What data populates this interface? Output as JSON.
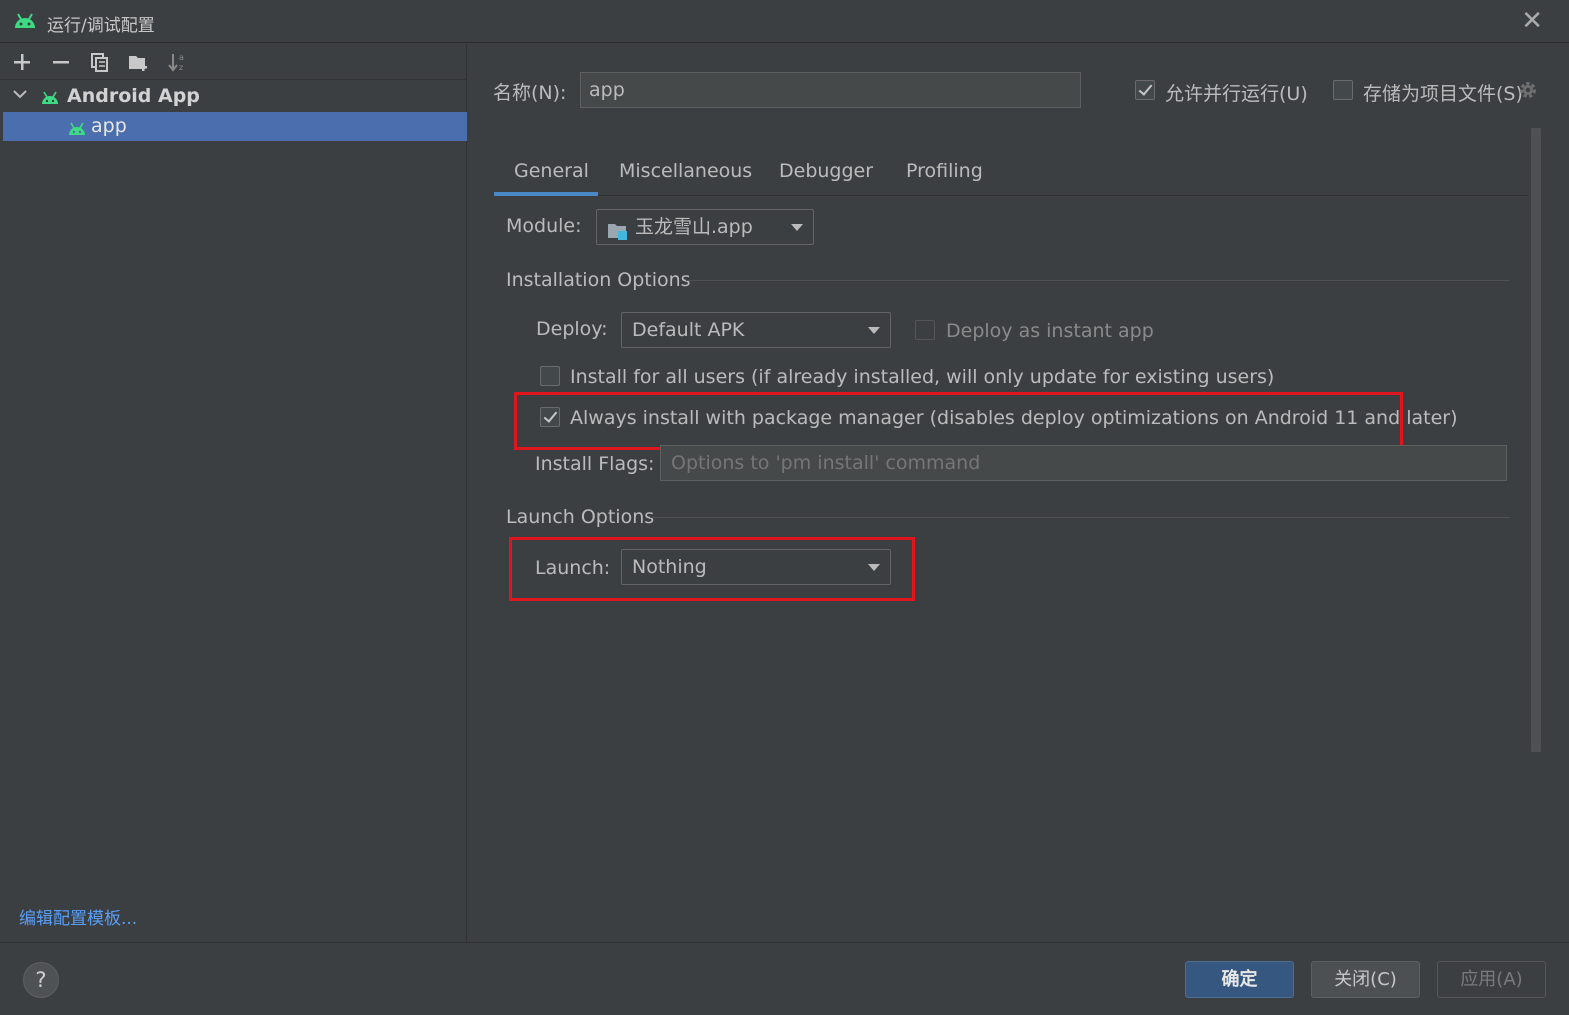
{
  "window": {
    "title": "运行/调试配置",
    "close_symbol": "✕"
  },
  "sidebar": {
    "toolbar_icons": [
      "add-icon",
      "remove-icon",
      "copy-icon",
      "new-folder-icon",
      "sort-icon"
    ],
    "root": {
      "label": "Android App",
      "icon": "android-icon",
      "expanded": true
    },
    "child": {
      "label": "app",
      "icon": "android-icon",
      "selected": true
    },
    "edit_templates_link": "编辑配置模板..."
  },
  "header": {
    "name_label": "名称(N):",
    "name_value": "app",
    "allow_parallel": {
      "label": "允许并行运行(U)",
      "checked": true
    },
    "store_as_file": {
      "label": "存储为项目文件(S)",
      "checked": false
    }
  },
  "tabs": [
    {
      "label": "General",
      "active": true
    },
    {
      "label": "Miscellaneous",
      "active": false
    },
    {
      "label": "Debugger",
      "active": false
    },
    {
      "label": "Profiling",
      "active": false
    }
  ],
  "general": {
    "module_label": "Module:",
    "module_value": "玉龙雪山.app",
    "installation_title": "Installation Options",
    "deploy_label": "Deploy:",
    "deploy_value": "Default APK",
    "instant_app": {
      "label": "Deploy as instant app",
      "checked": false,
      "disabled": true
    },
    "install_all_users": {
      "label": "Install for all users (if already installed, will only update for existing users)",
      "checked": false
    },
    "always_pm": {
      "label": "Always install with package manager (disables deploy optimizations on Android 11 and later)",
      "checked": true
    },
    "install_flags_label": "Install Flags:",
    "install_flags_placeholder": "Options to 'pm install' command",
    "launch_title": "Launch Options",
    "launch_label": "Launch:",
    "launch_value": "Nothing"
  },
  "footer": {
    "help_symbol": "?",
    "ok_label": "确定",
    "close_label": "关闭(C)",
    "apply_label": "应用(A)"
  },
  "colors": {
    "background": "#3c3f41",
    "selection": "#4b6eaf",
    "highlight_box": "#e0161e",
    "link": "#589df6",
    "primary_button": "#365880",
    "android_green": "#3ddc84"
  }
}
